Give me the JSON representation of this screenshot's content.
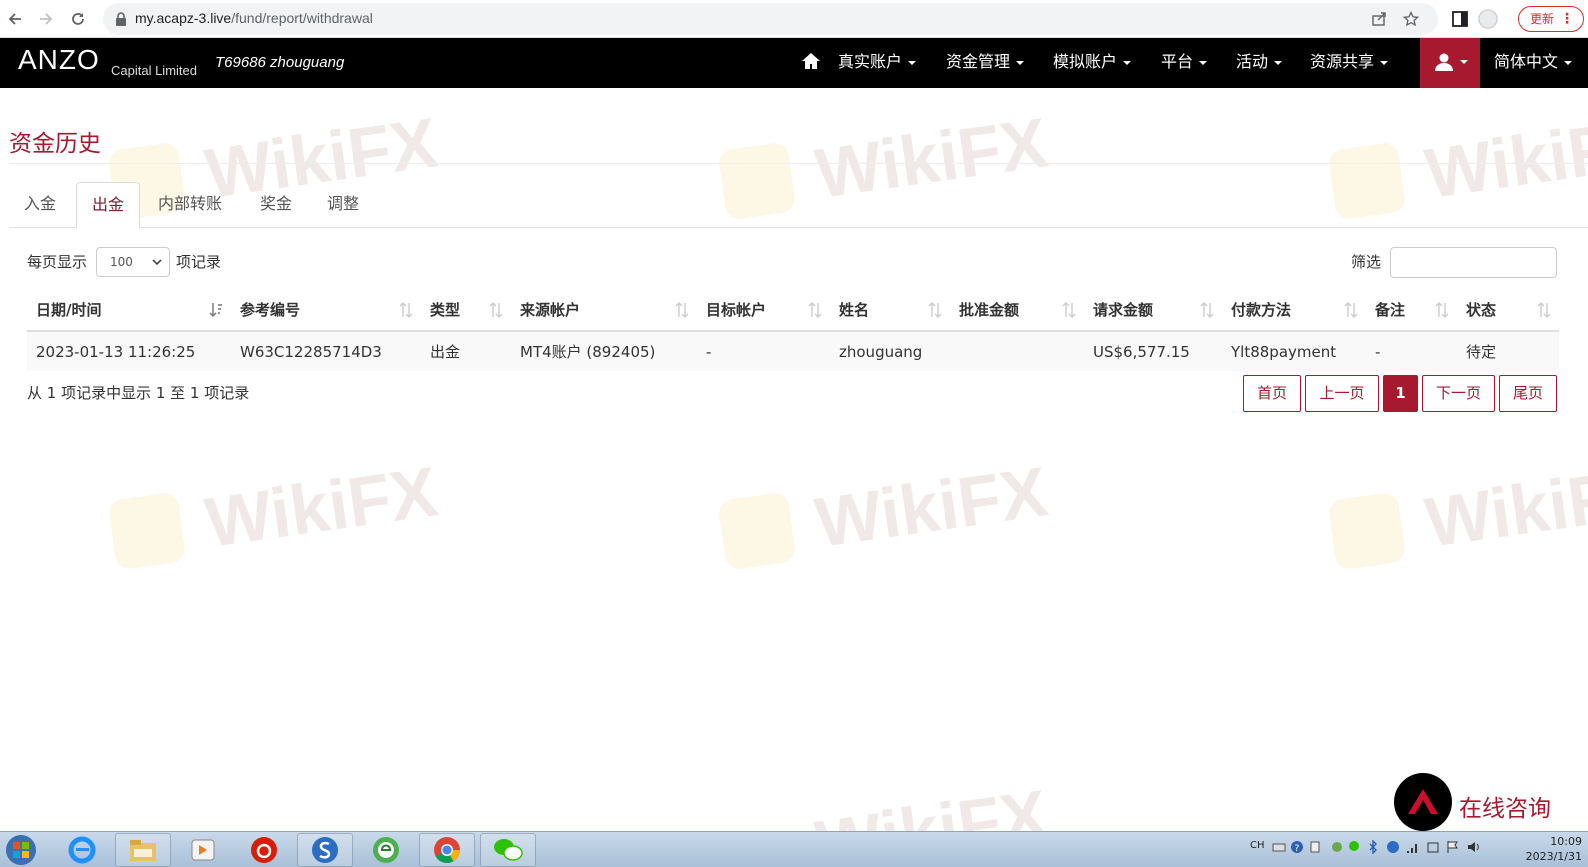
{
  "browser": {
    "url_host": "my.acapz-3.live",
    "url_path": "/fund/report/withdrawal",
    "update_label": "更新",
    "menu_label": "⋮"
  },
  "navbar": {
    "logo_text": "ANZO",
    "logo_subtext": "Capital Limited",
    "account": "T69686 zhouguang",
    "items": [
      {
        "label": "真实账户"
      },
      {
        "label": "资金管理"
      },
      {
        "label": "模拟账户"
      },
      {
        "label": "平台"
      },
      {
        "label": "活动"
      },
      {
        "label": "资源共享"
      }
    ],
    "language": "简体中文"
  },
  "page": {
    "title": "资金历史",
    "tabs": [
      {
        "label": "入金"
      },
      {
        "label": "出金",
        "active": true
      },
      {
        "label": "内部转账"
      },
      {
        "label": "奖金"
      },
      {
        "label": "调整"
      }
    ],
    "length_prefix": "每页显示",
    "length_value": "100",
    "length_suffix": "项记录",
    "filter_label": "筛选"
  },
  "table": {
    "columns": [
      "日期/时间",
      "参考编号",
      "类型",
      "来源帐户",
      "目标帐户",
      "姓名",
      "批准金额",
      "请求金额",
      "付款方法",
      "备注",
      "状态"
    ],
    "rows": [
      [
        "2023-01-13 11:26:25",
        "W63C12285714D3",
        "出金",
        "MT4账户 (892405)",
        "-",
        "zhouguang",
        "",
        "US$6,577.15",
        "Ylt88payment",
        "-",
        "待定"
      ]
    ]
  },
  "pagination": {
    "info": "从 1 项记录中显示 1 至 1 项记录",
    "first": "首页",
    "prev": "上一页",
    "current": "1",
    "next": "下一页",
    "last": "尾页"
  },
  "watermark": "WikiFX",
  "chat_widget": {
    "label": "在线咨询"
  },
  "taskbar": {
    "tray_lang": "CH",
    "time": "10:09",
    "date": "2023/1/31"
  },
  "colors": {
    "brand": "#a6192e",
    "navbar": "#000000"
  }
}
